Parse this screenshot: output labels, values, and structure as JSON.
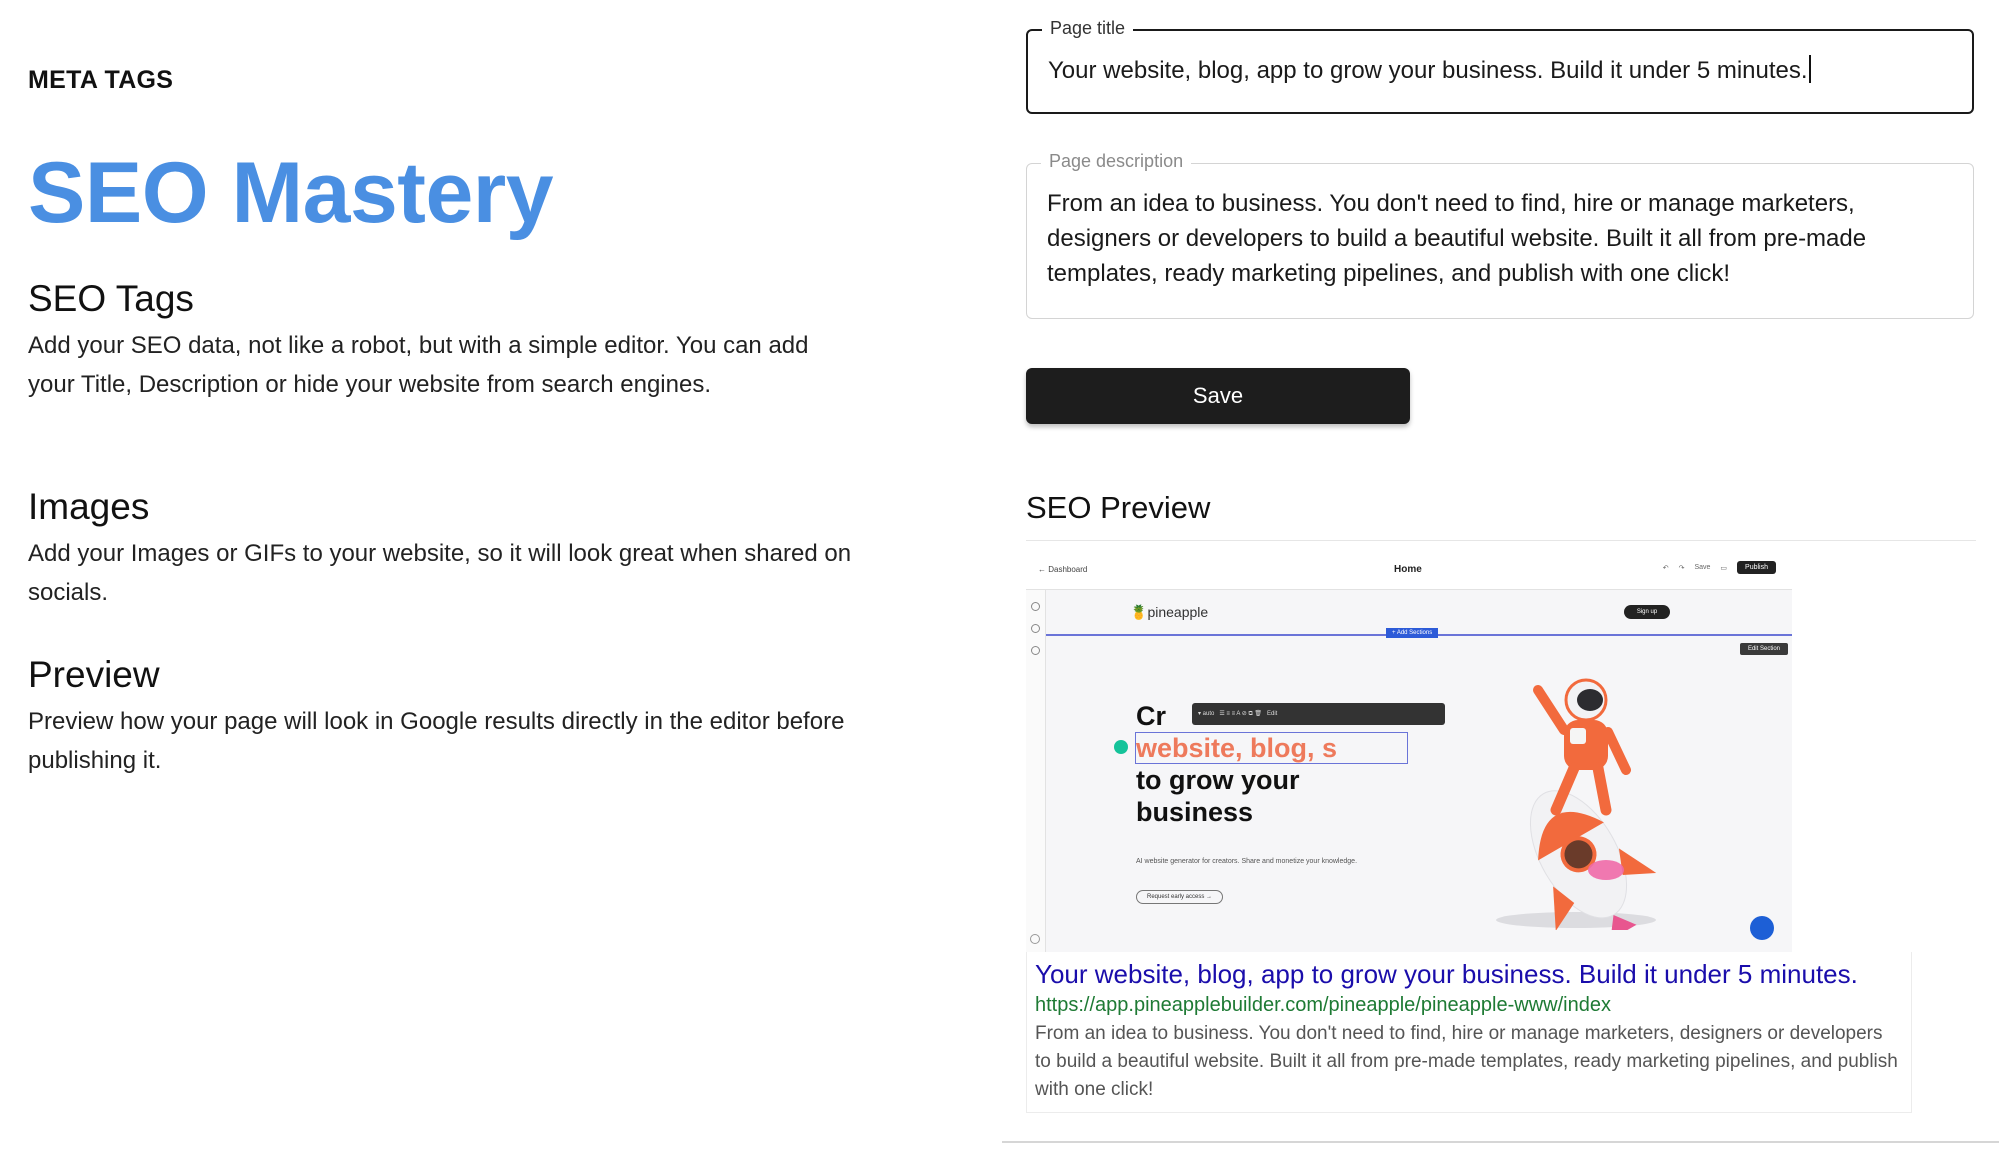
{
  "left": {
    "eyebrow": "META TAGS",
    "headline": "SEO Mastery",
    "features": [
      {
        "title": "SEO Tags",
        "body": "Add your SEO data, not like a robot, but with a simple editor. You can add your Title, Description or hide your website from search engines."
      },
      {
        "title": "Images",
        "body": "Add your Images or GIFs to your website, so it will look great when shared on socials."
      },
      {
        "title": "Preview",
        "body": "Preview how your page will look in Google results directly in the editor before publishing it."
      }
    ]
  },
  "form": {
    "title_label": "Page title",
    "title_value": "Your website, blog, app to grow your business. Build it under 5 minutes.",
    "description_label": "Page description",
    "description_value": "From an idea to business. You don't need to find, hire or manage marketers, designers or developers to build a beautiful website. Built it all from pre-made templates, ready marketing pipelines, and publish with one click!",
    "save_label": "Save"
  },
  "preview": {
    "heading": "SEO Preview",
    "thumbnail": {
      "back_link": "← Dashboard",
      "page_name": "Home",
      "save": "Save",
      "publish": "Publish",
      "logo_text": "pineapple",
      "signup": "Sign up",
      "add_sections": "+ Add Sections",
      "edit_section": "Edit Section",
      "headline_1": "Cr",
      "headline_2": "website, blog, s",
      "headline_3": "to grow your",
      "headline_4": "business",
      "subtext": "AI website generator for creators. Share and monetize your knowledge.",
      "cta": "Request early access →"
    },
    "serp_title": "Your website, blog, app to grow your business. Build it under 5 minutes.",
    "serp_url": "https://app.pineapplebuilder.com/pineapple/pineapple-www/index",
    "serp_description": "From an idea to business. You don't need to find, hire or manage marketers, designers or developers to build a beautiful website. Built it all from pre-made templates, ready marketing pipelines, and publish with one click!"
  },
  "colors": {
    "accent": "#4a8fe2",
    "serp_title": "#1a0dab",
    "serp_url": "#1e7a34",
    "button_bg": "#1d1d1d"
  }
}
